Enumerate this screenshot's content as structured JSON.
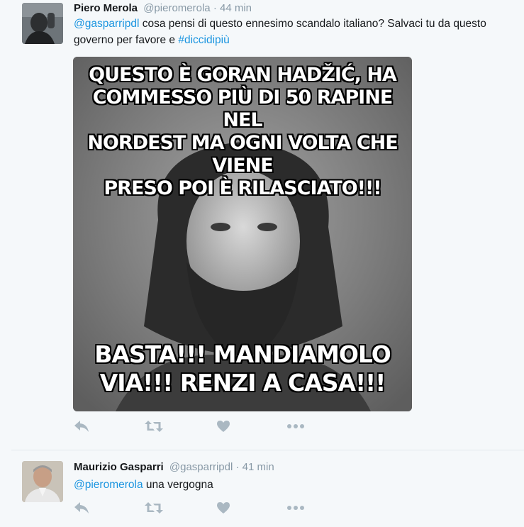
{
  "tweets": [
    {
      "fullname": "Piero Merola",
      "username": "@pieromerola",
      "dot": "·",
      "time": "44 min",
      "text_parts": {
        "mention": "@gasparripdl",
        "body": " cosa pensi di questo ennesimo scandalo italiano? Salvaci tu da questo governo per favore e ",
        "hashtag": "#diccidipiù"
      },
      "media_caption": {
        "top": [
          "QUESTO È GORAN HADŽIĆ, HA",
          "COMMESSO PIÙ DI 50 RAPINE NEL",
          "NORDEST MA OGNI VOLTA CHE VIENE",
          "PRESO POI È RILASCIATO!!!"
        ],
        "bottom": [
          "BASTA!!! MANDIAMOLO",
          "VIA!!! RENZI A CASA!!!"
        ]
      }
    },
    {
      "fullname": "Maurizio Gasparri",
      "username": "@gasparripdl",
      "dot": "·",
      "time": "41 min",
      "text_parts": {
        "mention": "@pieromerola",
        "body": " una vergogna"
      }
    }
  ],
  "action_icons": [
    "reply-icon",
    "retweet-icon",
    "like-icon",
    "more-icon"
  ],
  "colors": {
    "background": "#f5f8fa",
    "link": "#1b95e0",
    "muted": "#8899a6",
    "icon": "#aab8c2"
  }
}
